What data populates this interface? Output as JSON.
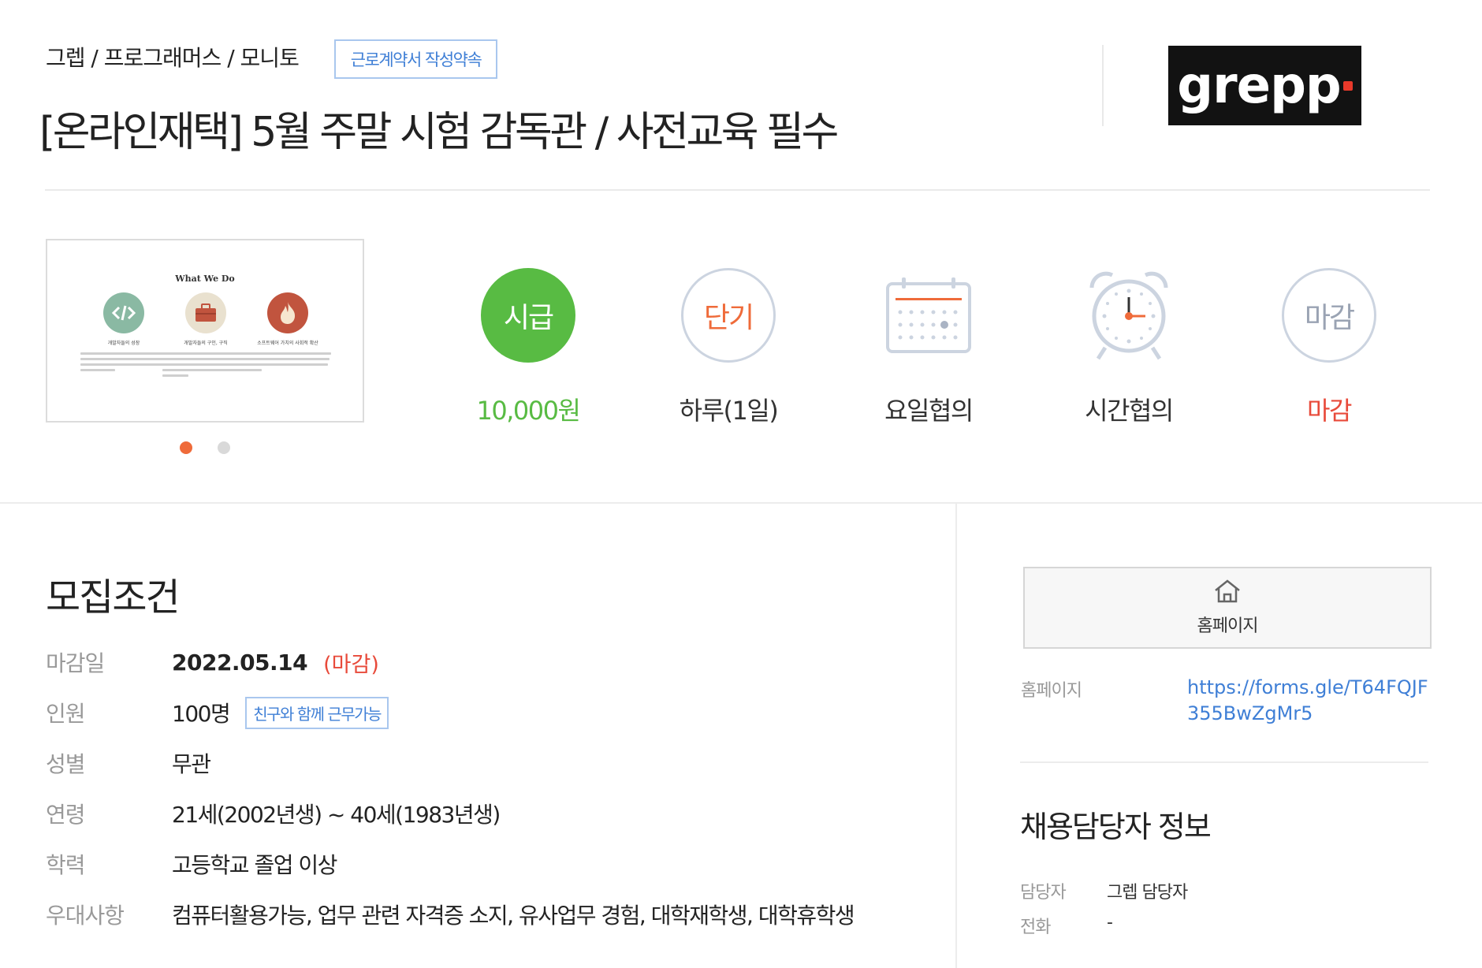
{
  "header": {
    "breadcrumb": "그렙 / 프로그래머스 / 모니토",
    "contract_badge": "근로계약서 작성약속",
    "title": "[온라인재택] 5월 주말 시험 감독관 / 사전교육 필수",
    "logo_text": "grepp"
  },
  "thumbnail": {
    "title": "What We Do",
    "items": [
      {
        "caption": "개발자들의 성장",
        "icon": "code-icon",
        "color": "#8ab9a3"
      },
      {
        "caption": "개발자들의 구인, 구직",
        "icon": "briefcase-icon",
        "color": "#e9e1cf"
      },
      {
        "caption": "소프트웨어 가치의 사회적 확산",
        "icon": "flame-icon",
        "color": "#c1543e"
      }
    ],
    "slide_count": 2,
    "active_slide": 1
  },
  "conditions": [
    {
      "badge": "시급",
      "label": "10,000원",
      "kind": "wage"
    },
    {
      "badge": "단기",
      "label": "하루(1일)",
      "kind": "period"
    },
    {
      "badge": "",
      "label": "요일협의",
      "kind": "calendar-icon"
    },
    {
      "badge": "",
      "label": "시간협의",
      "kind": "alarm-clock-icon"
    },
    {
      "badge": "마감",
      "label": "마감",
      "kind": "closed"
    }
  ],
  "requirements": {
    "title": "모집조건",
    "deadline": {
      "label": "마감일",
      "value": "2022.05.14",
      "status": "(마감)"
    },
    "headcount": {
      "label": "인원",
      "value": "100명",
      "badge": "친구와 함께 근무가능"
    },
    "gender": {
      "label": "성별",
      "value": "무관"
    },
    "age": {
      "label": "연령",
      "value": "21세(2002년생) ~ 40세(1983년생)"
    },
    "education": {
      "label": "학력",
      "value": "고등학교 졸업 이상"
    },
    "preferred": {
      "label": "우대사항",
      "value": "컴퓨터활용가능, 업무 관련 자격증 소지, 유사업무 경험, 대학재학생, 대학휴학생"
    }
  },
  "sidebar": {
    "home_button_label": "홈페이지",
    "homepage_label": "홈페이지",
    "homepage_url": "https://forms.gle/T64FQJF355BwZgMr5",
    "contact_title": "채용담당자 정보",
    "manager_label": "담당자",
    "manager_value": "그렙 담당자",
    "phone_label": "전화",
    "phone_value": "-"
  },
  "colors": {
    "green": "#58bb43",
    "orange": "#ef6b3a",
    "red": "#e84a3a",
    "blue": "#3f7fd6",
    "circle_border": "#ccd4e0",
    "gray_text": "#999999"
  }
}
